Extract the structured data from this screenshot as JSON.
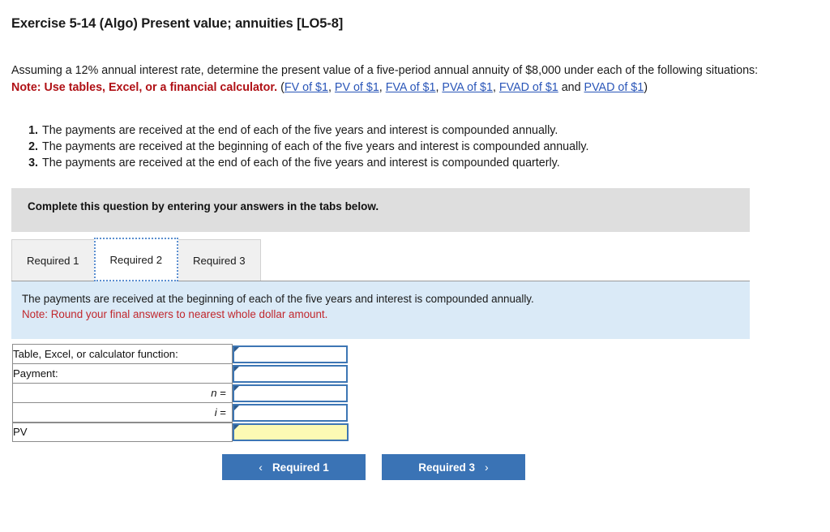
{
  "exercise": {
    "title": "Exercise 5-14 (Algo) Present value; annuities [LO5-8]",
    "statement": "Assuming a 12% annual interest rate, determine the present value of a five-period annual annuity of $8,000 under each of the following situations:",
    "note_label": "Note: Use tables, Excel, or a financial calculator.",
    "links_open": "(",
    "links_close": ")",
    "links_conjunction": " and ",
    "links_separator": ", ",
    "links": [
      "FV of $1",
      "PV of $1",
      "FVA of $1",
      "PVA of $1",
      "FVAD of $1",
      "PVAD of $1"
    ],
    "situations": [
      {
        "num": "1.",
        "text": "The payments are received at the end of each of the five years and interest is compounded annually."
      },
      {
        "num": "2.",
        "text": "The payments are received at the beginning of each of the five years and interest is compounded annually."
      },
      {
        "num": "3.",
        "text": "The payments are received at the end of each of the five years and interest is compounded quarterly."
      }
    ]
  },
  "instruction_bar": {
    "text": "Complete this question by entering your answers in the tabs below."
  },
  "tabs": [
    {
      "label": "Required 1",
      "active": false
    },
    {
      "label": "Required 2",
      "active": true
    },
    {
      "label": "Required 3",
      "active": false
    }
  ],
  "info_panel": {
    "line1": "The payments are received at the beginning of each of the five years and interest is compounded annually.",
    "line2": "Note: Round your final answers to nearest whole dollar amount."
  },
  "answer_table": {
    "rows": [
      {
        "label": "Table, Excel, or calculator function:",
        "align": "left",
        "value": "",
        "highlight": false,
        "total": false
      },
      {
        "label": "Payment:",
        "align": "left",
        "value": "",
        "highlight": false,
        "total": false
      },
      {
        "label": "n =",
        "align": "right",
        "value": "",
        "highlight": false,
        "total": false
      },
      {
        "label": "i =",
        "align": "right",
        "value": "",
        "highlight": false,
        "total": false
      },
      {
        "label": "PV",
        "align": "left",
        "value": "",
        "highlight": true,
        "total": true
      }
    ]
  },
  "navigation": {
    "prev_label": "Required 1",
    "prev_icon": "chevron-left-icon",
    "next_label": "Required 3",
    "next_icon": "chevron-right-icon",
    "chevron_left": "‹",
    "chevron_right": "›"
  },
  "colors": {
    "link": "#2a56b8",
    "note_red": "#b01116",
    "info_red": "#c1272d",
    "instruction_bg": "#dedede",
    "info_bg": "#daeaf7",
    "field_border": "#3d76b4",
    "highlight_field": "#fcfab4",
    "button_blue": "#3a73b5"
  }
}
